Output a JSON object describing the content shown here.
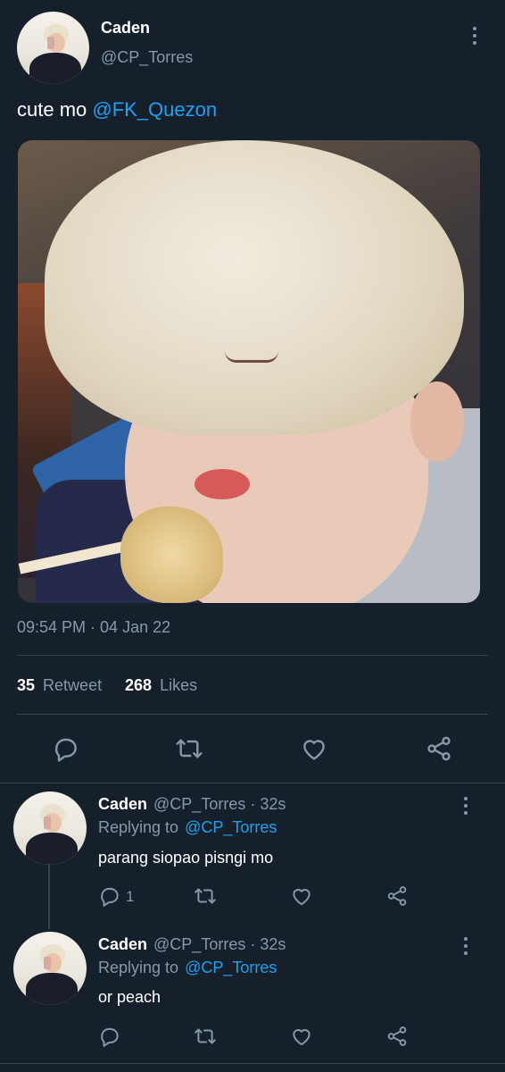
{
  "tweet": {
    "author_name": "Caden",
    "author_handle": "@CP_Torres",
    "text_prefix": "cute mo ",
    "mention": "@FK_Quezon",
    "timestamp": "09:54 PM · 04 Jan 22",
    "retweet_count": "35",
    "retweet_label": "Retweet",
    "like_count": "268",
    "like_label": "Likes"
  },
  "replies": [
    {
      "name": "Caden",
      "handle_time": "@CP_Torres · 32s",
      "replying_label": "Replying to",
      "replying_to": "@CP_Torres",
      "text": "parang siopao pisngi mo",
      "reply_count": "1"
    },
    {
      "name": "Caden",
      "handle_time": "@CP_Torres · 32s",
      "replying_label": "Replying to",
      "replying_to": "@CP_Torres",
      "text": "or peach",
      "reply_count": ""
    }
  ],
  "colors": {
    "background": "#15202b",
    "accent": "#1da1f2",
    "muted": "#8899a6",
    "divider": "#38444d"
  },
  "icons": [
    "reply-icon",
    "retweet-icon",
    "like-icon",
    "share-icon",
    "more-icon"
  ]
}
